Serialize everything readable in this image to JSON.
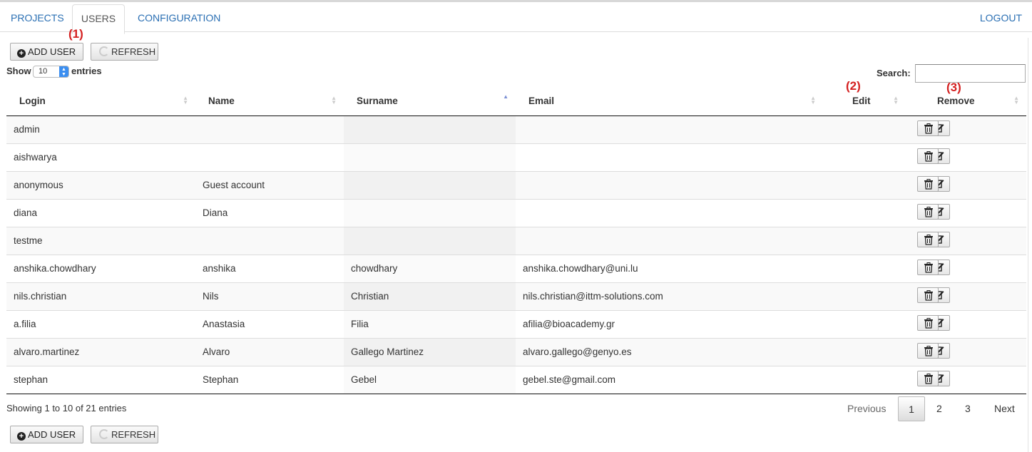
{
  "nav": {
    "projects": "PROJECTS",
    "users": "USERS",
    "configuration": "CONFIGURATION",
    "logout": "LOGOUT"
  },
  "annotations": {
    "a1": "(1)",
    "a2": "(2)",
    "a3": "(3)"
  },
  "toolbar": {
    "add_user": "ADD USER",
    "refresh": "REFRESH"
  },
  "length": {
    "show": "Show",
    "value": "10",
    "entries": "entries"
  },
  "search": {
    "label": "Search:",
    "value": ""
  },
  "table": {
    "headers": [
      "Login",
      "Name",
      "Surname",
      "Email",
      "Edit",
      "Remove"
    ],
    "sorted_column": "Surname",
    "rows": [
      {
        "login": "admin",
        "name": "",
        "surname": "",
        "email": ""
      },
      {
        "login": "aishwarya",
        "name": "",
        "surname": "",
        "email": ""
      },
      {
        "login": "anonymous",
        "name": "Guest account",
        "surname": "",
        "email": ""
      },
      {
        "login": "diana",
        "name": "Diana",
        "surname": "",
        "email": ""
      },
      {
        "login": "testme",
        "name": "",
        "surname": "",
        "email": ""
      },
      {
        "login": "anshika.chowdhary",
        "name": "anshika",
        "surname": "chowdhary",
        "email": "anshika.chowdhary@uni.lu"
      },
      {
        "login": "nils.christian",
        "name": "Nils",
        "surname": "Christian",
        "email": "nils.christian@ittm-solutions.com"
      },
      {
        "login": "a.filia",
        "name": "Anastasia",
        "surname": "Filia",
        "email": "afilia@bioacademy.gr"
      },
      {
        "login": "alvaro.martinez",
        "name": "Alvaro",
        "surname": "Gallego Martinez",
        "email": "alvaro.gallego@genyo.es"
      },
      {
        "login": "stephan",
        "name": "Stephan",
        "surname": "Gebel",
        "email": "gebel.ste@gmail.com"
      }
    ]
  },
  "footer": {
    "info": "Showing 1 to 10 of 21 entries",
    "previous": "Previous",
    "pages": [
      "1",
      "2",
      "3"
    ],
    "current_page": "1",
    "next": "Next"
  },
  "icons": {
    "add": "plus-circle-icon",
    "refresh": "refresh-icon",
    "edit": "edit-icon",
    "remove": "trash-icon"
  }
}
